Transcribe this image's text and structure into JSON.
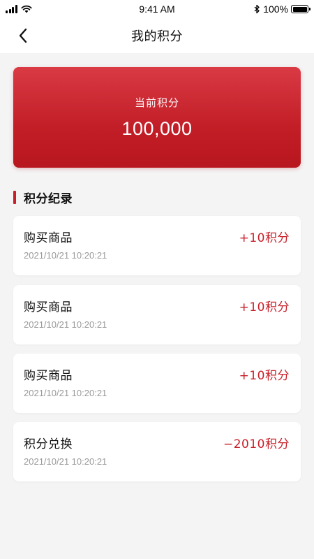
{
  "status_bar": {
    "time": "9:41 AM",
    "battery": "100%",
    "battery_level": 1.0
  },
  "nav": {
    "title": "我的积分"
  },
  "points_card": {
    "label": "当前积分",
    "value": "100,000"
  },
  "section": {
    "title": "积分纪录"
  },
  "records": [
    {
      "title": "购买商品",
      "time": "2021/10/21 10:20:21",
      "amount": "+10积分"
    },
    {
      "title": "购买商品",
      "time": "2021/10/21 10:20:21",
      "amount": "+10积分"
    },
    {
      "title": "购买商品",
      "time": "2021/10/21 10:20:21",
      "amount": "+10积分"
    },
    {
      "title": "积分兑换",
      "time": "2021/10/21 10:20:21",
      "amount": "−2010积分"
    }
  ],
  "colors": {
    "accent": "#c8202a",
    "card_gradient_top": "#d93a44",
    "card_gradient_bottom": "#b8161f",
    "background": "#f4f4f4"
  },
  "icons": {
    "back": "chevron-left-icon",
    "signal": "signal-icon",
    "wifi": "wifi-icon",
    "bluetooth": "bluetooth-icon",
    "battery": "battery-icon"
  }
}
